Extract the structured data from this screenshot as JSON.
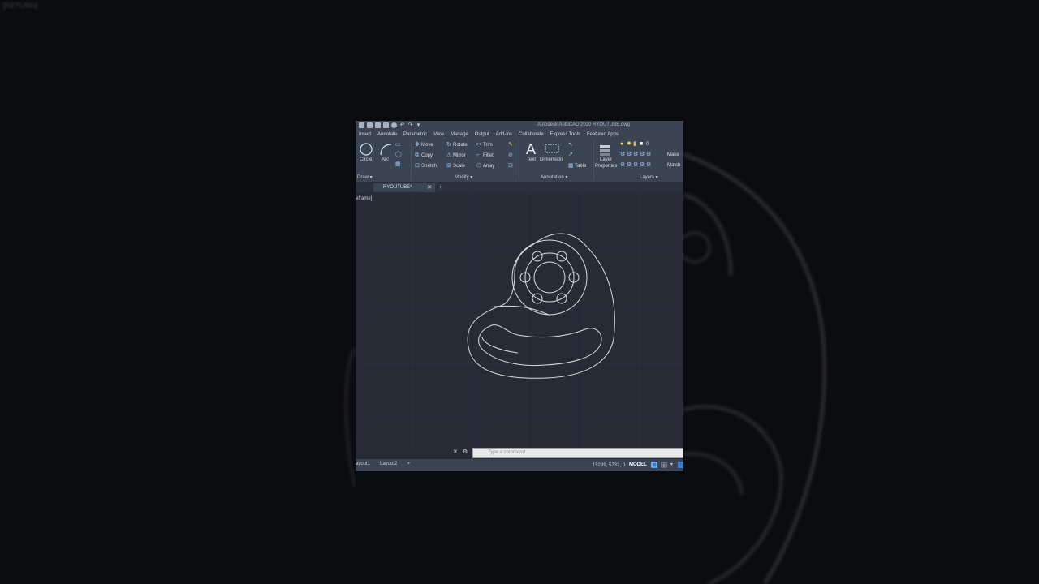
{
  "left_blur": {
    "corner_text": "[RETURN]"
  },
  "app": {
    "title": "Autodesk AutoCAD 2020  RYOUTUBE.dwg"
  },
  "menu": [
    "Insert",
    "Annotate",
    "Parametric",
    "View",
    "Manage",
    "Output",
    "Add-ins",
    "Collaborate",
    "Express Tools",
    "Featured Apps"
  ],
  "ribbon": {
    "draw": {
      "circle": "Circle",
      "arc": "Arc",
      "panel": "Draw ▾"
    },
    "modify": {
      "move": "Move",
      "rotate": "Rotate",
      "trim": "Trim",
      "copy": "Copy",
      "mirror": "Mirror",
      "fillet": "Fillet",
      "stretch": "Stretch",
      "scale": "Scale",
      "array": "Array",
      "panel": "Modify ▾"
    },
    "annotation": {
      "text": "Text",
      "dimension": "Dimension",
      "table": "Table",
      "panel": "Annotation ▾"
    },
    "layers": {
      "layer_properties_1": "Layer",
      "layer_properties_2": "Properties",
      "layer_name": "0",
      "match_1": "Make",
      "match_2": "Match",
      "panel": "Layers ▾"
    }
  },
  "doc_tab": {
    "name": "RYOUTUBE*",
    "close": "✕",
    "add": "+"
  },
  "viewport": {
    "label": "eframe]"
  },
  "command": {
    "placeholder": "Type a command",
    "close": "✕",
    "wrench": "⚙"
  },
  "status": {
    "layout1": "ayout1",
    "layout2": "Layout2",
    "add": "+",
    "coords": "15299, 5732, 0",
    "model": "MODEL"
  },
  "colors": {
    "background": "#262b35",
    "ribbon": "#3b4453",
    "geometry": "#d9dde3",
    "accent": "#2f7fd1"
  }
}
